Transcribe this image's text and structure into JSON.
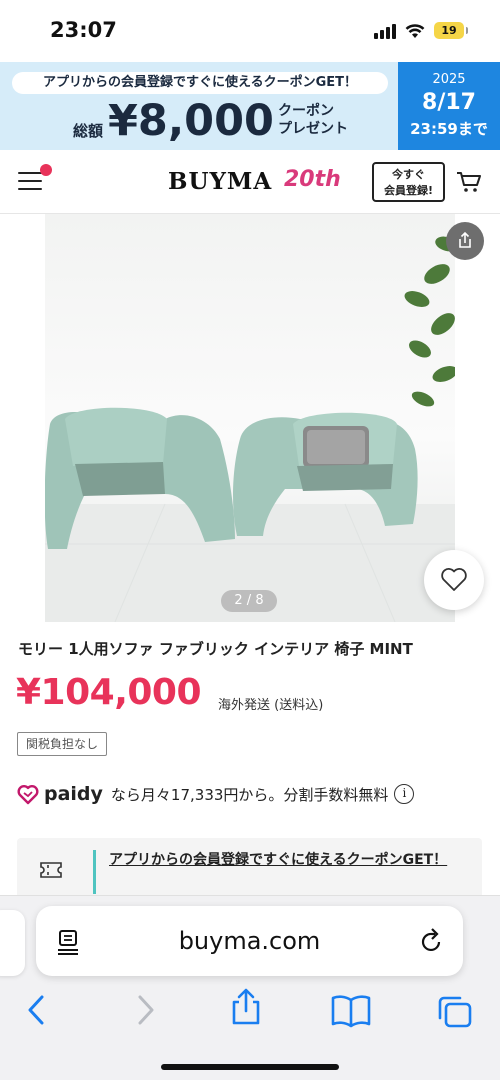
{
  "status_bar": {
    "time": "23:07",
    "battery": "19",
    "icons": [
      "signal-icon",
      "wifi-icon",
      "battery-icon"
    ]
  },
  "promo": {
    "headline": "アプリからの会員登録ですぐに使えるクーポンGET！",
    "total_label": "総額",
    "amount": "¥8,000",
    "coupon_line1": "クーポン",
    "coupon_line2": "プレゼント",
    "year": "2025",
    "date": "8/17",
    "until": "23:59まで",
    "colors": {
      "left_bg": "#d6ecf9",
      "right_bg": "#1e86e0"
    }
  },
  "header": {
    "logo": "BUYMA",
    "logo_badge": "20th",
    "register_line1": "今すぐ",
    "register_line2": "会員登録!",
    "icons": [
      "menu-icon",
      "cart-icon"
    ]
  },
  "product": {
    "pager": "2 / 8",
    "title": "モリー 1人用ソファ ファブリック インテリア 椅子 MINT",
    "price": "¥104,000",
    "shipping": "海外発送 (送料込)",
    "tax_badge": "関税負担なし",
    "paidy_logo": "paidy",
    "paidy_text": "なら月々17,333円から。分割手数料無料",
    "coupon_text": "アプリからの会員登録ですぐに使えるクーポンGET！",
    "colors": {
      "price": "#e8335a",
      "accent_bar": "#4fc4c0"
    }
  },
  "safari": {
    "url": "buyma.com",
    "icons": [
      "reader-icon",
      "reload-icon",
      "back-icon",
      "forward-icon",
      "share-icon",
      "bookmarks-icon",
      "tabs-icon"
    ]
  }
}
